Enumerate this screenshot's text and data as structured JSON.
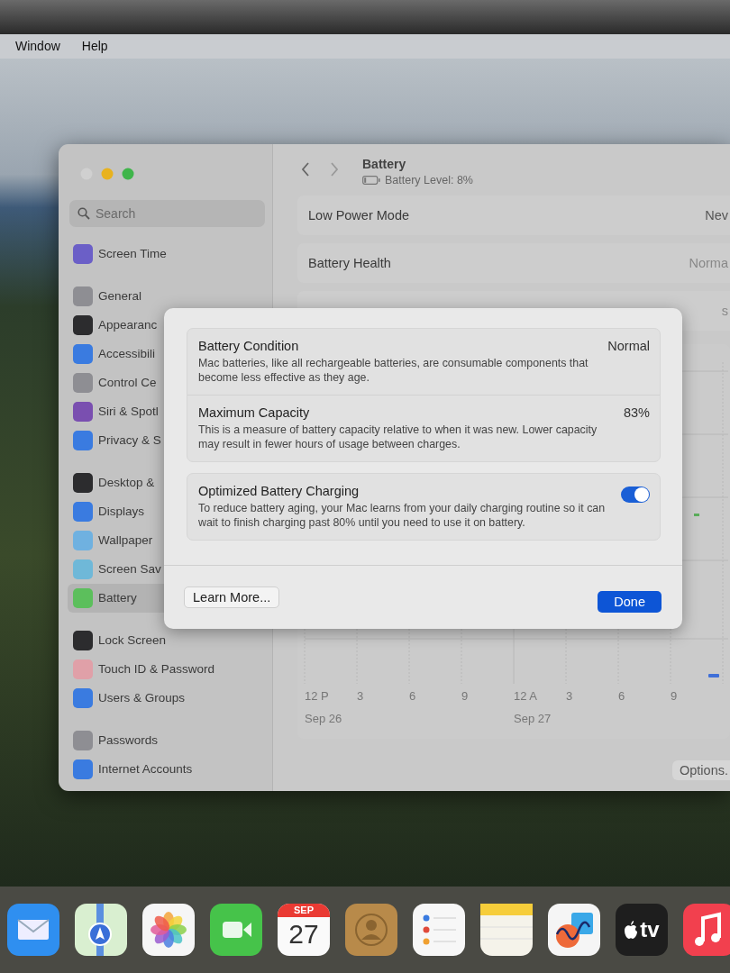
{
  "menu_bar": {
    "items": [
      "Window",
      "Help"
    ]
  },
  "sidebar": {
    "search": {
      "placeholder": "Search"
    },
    "groups": [
      {
        "items": [
          {
            "label": "Screen Time",
            "color": "#6b5fc7",
            "selected": false
          }
        ]
      },
      {
        "items": [
          {
            "label": "General",
            "color": "#8e8e93",
            "selected": false
          },
          {
            "label": "Appearanc",
            "color": "#2c2c2e",
            "selected": false
          },
          {
            "label": "Accessibili",
            "color": "#3a7be0",
            "selected": false
          },
          {
            "label": "Control Ce",
            "color": "#8e8e93",
            "selected": false
          },
          {
            "label": "Siri & Spotl",
            "color": "#7a4fb0",
            "selected": false
          },
          {
            "label": "Privacy & S",
            "color": "#3a7be0",
            "selected": false
          }
        ]
      },
      {
        "items": [
          {
            "label": "Desktop &",
            "color": "#2c2c2e",
            "selected": false
          },
          {
            "label": "Displays",
            "color": "#3a7be0",
            "selected": false
          },
          {
            "label": "Wallpaper",
            "color": "#6fb1e0",
            "selected": false
          },
          {
            "label": "Screen Sav",
            "color": "#6fb8d8",
            "selected": false
          },
          {
            "label": "Battery",
            "color": "#5cbf5c",
            "selected": true
          }
        ]
      },
      {
        "items": [
          {
            "label": "Lock Screen",
            "color": "#2c2c2e",
            "selected": false
          },
          {
            "label": "Touch ID & Password",
            "color": "#e0a0a8",
            "selected": false
          },
          {
            "label": "Users & Groups",
            "color": "#3a7be0",
            "selected": false
          }
        ]
      },
      {
        "items": [
          {
            "label": "Passwords",
            "color": "#8e8e93",
            "selected": false
          },
          {
            "label": "Internet Accounts",
            "color": "#3a7be0",
            "selected": false
          }
        ]
      }
    ]
  },
  "header": {
    "title": "Battery",
    "subtitle": "Battery Level: 8%"
  },
  "settings_rows": [
    {
      "label": "Low Power Mode",
      "value": "Nev"
    },
    {
      "label": "Battery Health",
      "value": "Norma"
    },
    {
      "value": "s"
    }
  ],
  "usage_chart": {
    "hour_labels": [
      "12 P",
      "3",
      "6",
      "9",
      "12 A",
      "3",
      "6",
      "9"
    ],
    "date_labels": [
      "Sep 26",
      "Sep 27"
    ]
  },
  "options_button": "Options.",
  "sheet": {
    "groups": [
      {
        "items": [
          {
            "kind": "info",
            "title": "Battery Condition",
            "description": "Mac batteries, like all rechargeable batteries, are consumable components that become less effective as they age.",
            "value": "Normal"
          },
          {
            "kind": "info",
            "title": "Maximum Capacity",
            "description": "This is a measure of battery capacity relative to when it was new. Lower capacity may result in fewer hours of usage between charges.",
            "value": "83%"
          }
        ]
      },
      {
        "items": [
          {
            "kind": "toggle",
            "title": "Optimized Battery Charging",
            "description": "To reduce battery aging, your Mac learns from your daily charging routine so it can wait to finish charging past 80% until you need to use it on battery.",
            "on": true
          }
        ]
      }
    ],
    "learn_more": "Learn More...",
    "done": "Done"
  },
  "dock": {
    "apps": [
      {
        "kind": "mail"
      },
      {
        "kind": "maps"
      },
      {
        "kind": "photos"
      },
      {
        "kind": "facetime"
      },
      {
        "kind": "calendar",
        "month": "SEP",
        "day": "27"
      },
      {
        "kind": "contacts"
      },
      {
        "kind": "reminders"
      },
      {
        "kind": "notes"
      },
      {
        "kind": "freeform"
      },
      {
        "kind": "tv",
        "label": "tv"
      },
      {
        "kind": "music"
      }
    ]
  }
}
